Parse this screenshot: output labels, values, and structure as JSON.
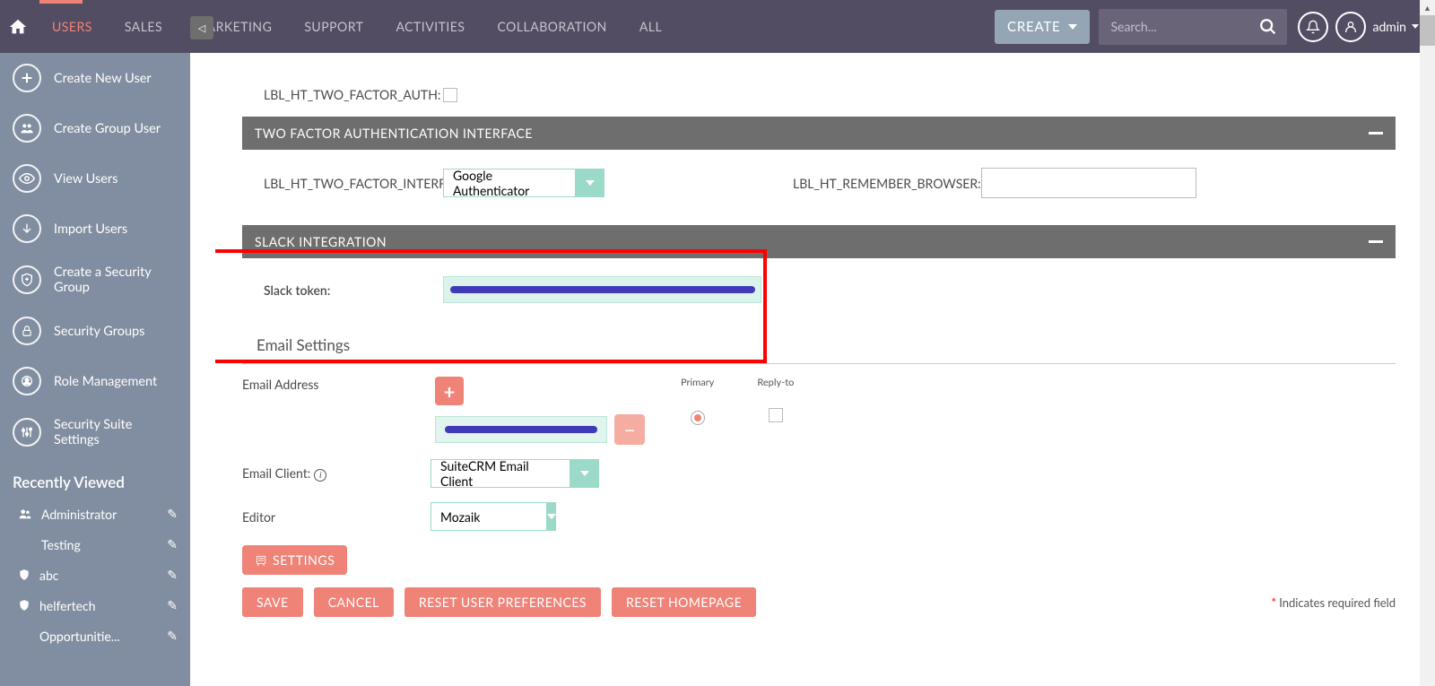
{
  "nav": {
    "items": [
      "USERS",
      "SALES",
      "MARKETING",
      "SUPPORT",
      "ACTIVITIES",
      "COLLABORATION",
      "ALL"
    ],
    "create": "CREATE",
    "search_placeholder": "Search...",
    "admin": "admin"
  },
  "sidebar": {
    "items": [
      {
        "label": "Create New User",
        "icon": "plus"
      },
      {
        "label": "Create Group User",
        "icon": "group"
      },
      {
        "label": "View Users",
        "icon": "eye"
      },
      {
        "label": "Import Users",
        "icon": "download"
      },
      {
        "label": "Create a Security Group",
        "icon": "shield-plus"
      },
      {
        "label": "Security Groups",
        "icon": "lock"
      },
      {
        "label": "Role Management",
        "icon": "role"
      },
      {
        "label": "Security Suite Settings",
        "icon": "sliders"
      }
    ],
    "recent_header": "Recently Viewed",
    "recent": [
      {
        "label": "Administrator",
        "icon": "person"
      },
      {
        "label": "Testing",
        "icon": "none"
      },
      {
        "label": "abc",
        "icon": "shield"
      },
      {
        "label": "helfertech",
        "icon": "shield"
      },
      {
        "label": "Opportunitie...",
        "icon": "none"
      }
    ]
  },
  "form": {
    "two_factor_auth_label": "LBL_HT_TWO_FACTOR_AUTH:",
    "panel_2fa_interface": "TWO FACTOR AUTHENTICATION INTERFACE",
    "two_factor_interface_label": "LBL_HT_TWO_FACTOR_INTERFACE:",
    "two_factor_interface_value": "Google Authenticator",
    "remember_browser_label": "LBL_HT_REMEMBER_BROWSER:",
    "panel_slack": "SLACK INTEGRATION",
    "slack_token_label": "Slack token:",
    "email_settings": "Email Settings",
    "email_address_label": "Email Address",
    "primary": "Primary",
    "reply_to": "Reply-to",
    "email_client_label": "Email Client:",
    "email_client_value": "SuiteCRM Email Client",
    "editor_label": "Editor",
    "editor_value": "Mozaik",
    "settings_btn": "SETTINGS",
    "save": "SAVE",
    "cancel": "CANCEL",
    "reset_prefs": "RESET USER PREFERENCES",
    "reset_home": "RESET HOMEPAGE",
    "required_note": "Indicates required field"
  }
}
